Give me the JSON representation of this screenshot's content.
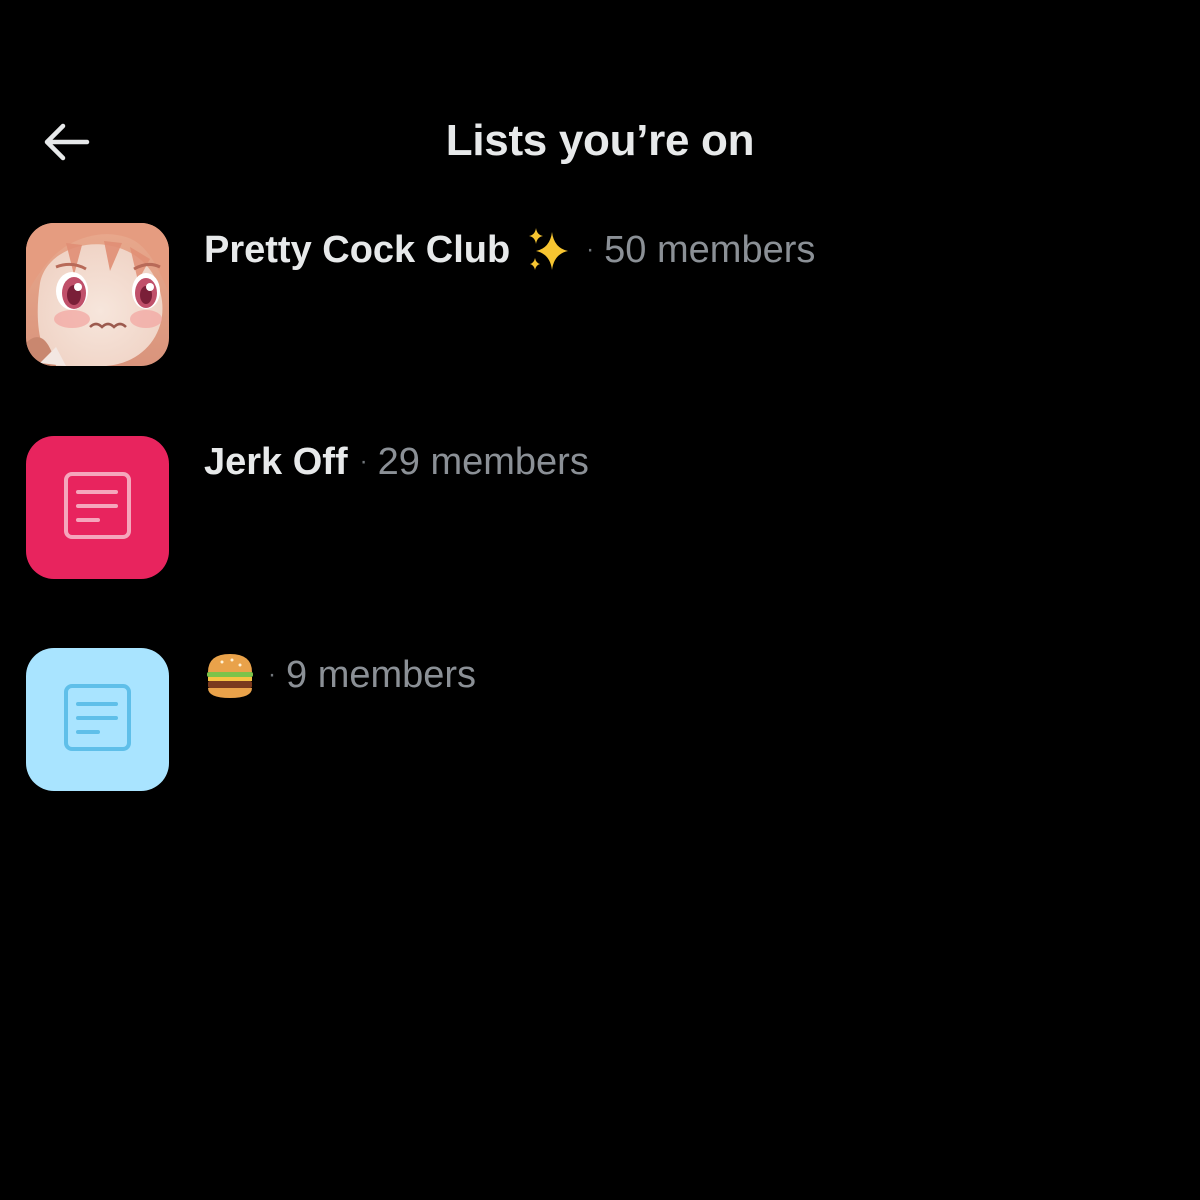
{
  "header": {
    "title": "Lists you’re on",
    "back_icon": "arrow-left-icon"
  },
  "lists": [
    {
      "name": "Pretty Cock Club",
      "name_emoji": "sparkles-icon",
      "members": "50 members",
      "avatar": "anime-girl-image"
    },
    {
      "name": "Jerk Off",
      "members": "29 members",
      "avatar": "list-icon",
      "avatar_color": "#e8245e"
    },
    {
      "name_emoji": "hamburger-icon",
      "members": "9 members",
      "avatar": "list-icon",
      "avatar_color": "#a9e4ff"
    }
  ],
  "separator": "·",
  "colors": {
    "background": "#000000",
    "primary_text": "#e7e9ea",
    "secondary_text": "#8b9096"
  }
}
